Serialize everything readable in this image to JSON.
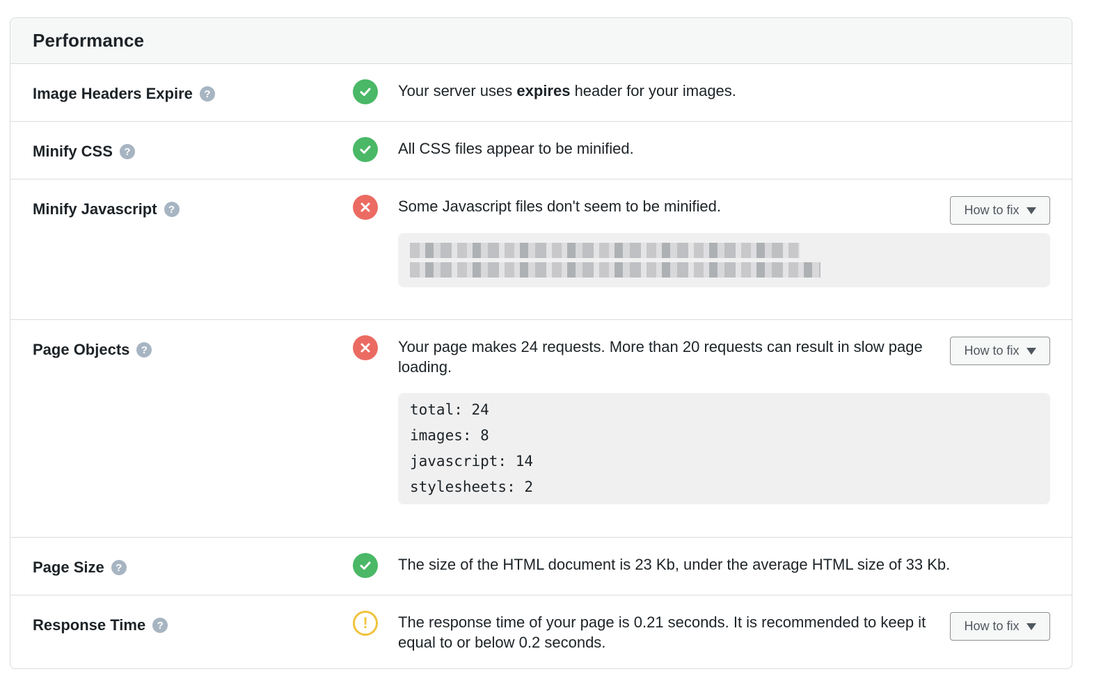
{
  "panel": {
    "title": "Performance"
  },
  "rows": [
    {
      "label": "Image Headers Expire",
      "status": "pass",
      "message_pre": "Your server uses ",
      "message_bold": "expires",
      "message_post": " header for your images."
    },
    {
      "label": "Minify CSS",
      "status": "pass",
      "message": "All CSS files appear to be minified."
    },
    {
      "label": "Minify Javascript",
      "status": "fail",
      "message": "Some Javascript files don't seem to be minified.",
      "fix_label": "How to fix",
      "details": "[redacted file list]"
    },
    {
      "label": "Page Objects",
      "status": "fail",
      "message": "Your page makes 24 requests. More than 20 requests can result in slow page loading.",
      "fix_label": "How to fix",
      "details_lines": [
        "total: 24",
        "images: 8",
        "javascript: 14",
        "stylesheets: 2"
      ]
    },
    {
      "label": "Page Size",
      "status": "pass",
      "message": "The size of the HTML document is 23 Kb, under the average HTML size of 33 Kb."
    },
    {
      "label": "Response Time",
      "status": "warning",
      "message": "The response time of your page is 0.21 seconds. It is recommended to keep it equal to or below 0.2 seconds.",
      "fix_label": "How to fix"
    }
  ],
  "icons": {
    "help": "?",
    "pass": "check-icon",
    "fail": "x-icon",
    "warning": "!"
  },
  "colors": {
    "pass": "#4ab866",
    "fail": "#eb6b62",
    "warning": "#f0c33c",
    "help": "#a7b4c2"
  }
}
